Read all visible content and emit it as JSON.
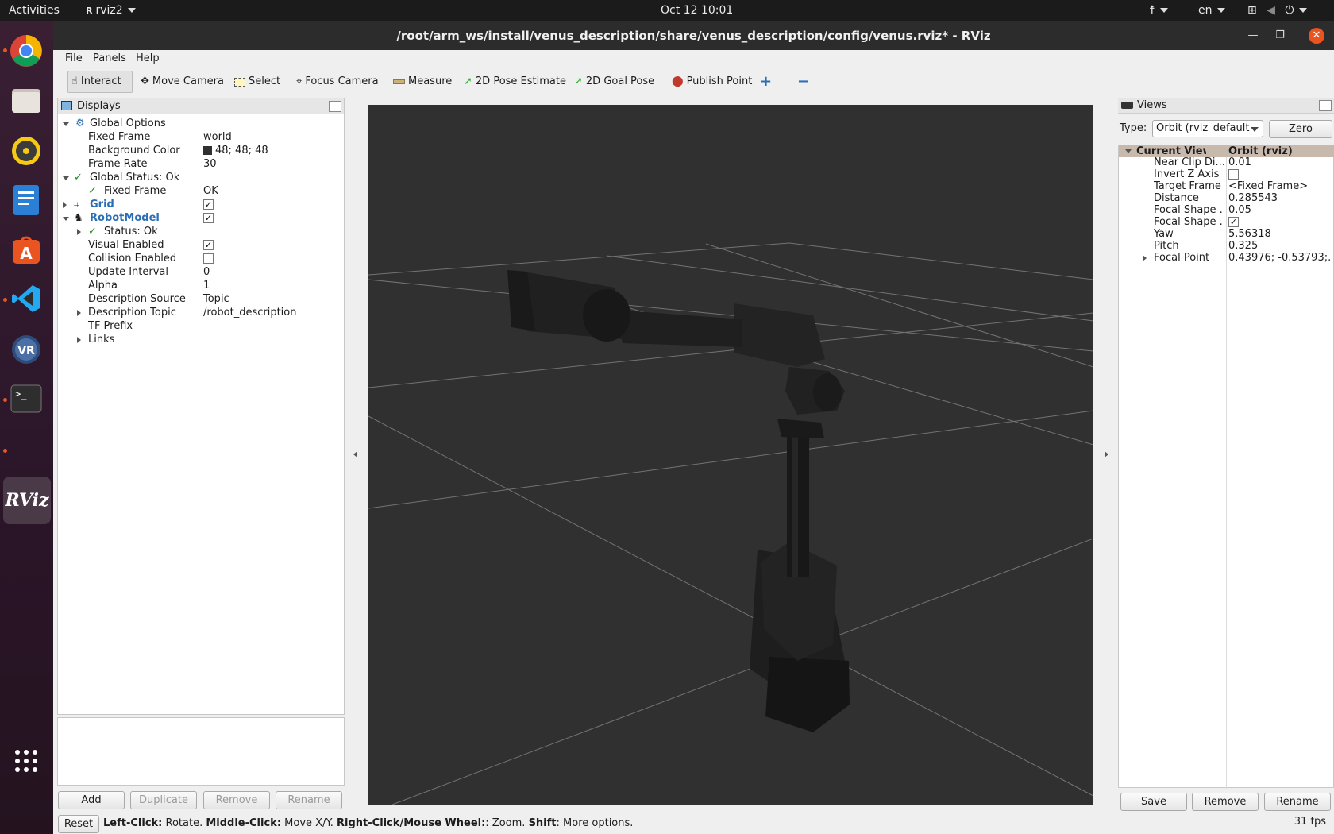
{
  "topbar": {
    "activities": "Activities",
    "app_name": "rviz2",
    "clock": "Oct 12  10:01",
    "lang": "en"
  },
  "window": {
    "title": "/root/arm_ws/install/venus_description/share/venus_description/config/venus.rviz* - RViz"
  },
  "menubar": {
    "items": [
      "File",
      "Panels",
      "Help"
    ]
  },
  "toolbar": {
    "tools": [
      "Interact",
      "Move Camera",
      "Select",
      "Focus Camera",
      "Measure",
      "2D Pose Estimate",
      "2D Goal Pose",
      "Publish Point"
    ]
  },
  "displays": {
    "title": "Displays",
    "rows": [
      {
        "label": "Global Options",
        "value": ""
      },
      {
        "label": "Fixed Frame",
        "value": "world"
      },
      {
        "label": "Background Color",
        "value": "48; 48; 48"
      },
      {
        "label": "Frame Rate",
        "value": "30"
      },
      {
        "label": "Global Status: Ok",
        "value": ""
      },
      {
        "label": "Fixed Frame",
        "value": "OK"
      },
      {
        "label": "Grid",
        "value": ""
      },
      {
        "label": "RobotModel",
        "value": ""
      },
      {
        "label": "Status: Ok",
        "value": ""
      },
      {
        "label": "Visual Enabled",
        "value": ""
      },
      {
        "label": "Collision Enabled",
        "value": ""
      },
      {
        "label": "Update Interval",
        "value": "0"
      },
      {
        "label": "Alpha",
        "value": "1"
      },
      {
        "label": "Description Source",
        "value": "Topic"
      },
      {
        "label": "Description Topic",
        "value": "/robot_description"
      },
      {
        "label": "TF Prefix",
        "value": ""
      },
      {
        "label": "Links",
        "value": ""
      }
    ],
    "checks": {
      "grid": true,
      "robotmodel": true,
      "visual_enabled": true,
      "collision_enabled": false
    },
    "buttons": [
      "Add",
      "Duplicate",
      "Remove",
      "Rename"
    ]
  },
  "views": {
    "title": "Views",
    "type_label": "Type:",
    "type_value": "Orbit (rviz_default_",
    "zero_label": "Zero",
    "header_left": "Current View",
    "header_right": "Orbit (rviz)",
    "rows": [
      {
        "label": "Near Clip Di...",
        "value": "0.01"
      },
      {
        "label": "Invert Z Axis",
        "value": ""
      },
      {
        "label": "Target Frame",
        "value": "<Fixed Frame>"
      },
      {
        "label": "Distance",
        "value": "0.285543"
      },
      {
        "label": "Focal Shape ...",
        "value": "0.05"
      },
      {
        "label": "Focal Shape ...",
        "value": ""
      },
      {
        "label": "Yaw",
        "value": "5.56318"
      },
      {
        "label": "Pitch",
        "value": "0.325"
      },
      {
        "label": "Focal Point",
        "value": "0.43976; -0.53793;..."
      }
    ],
    "checks": {
      "invert_z": false,
      "focal_shape_fixed": true
    },
    "buttons": [
      "Save",
      "Remove",
      "Rename"
    ]
  },
  "statusbar": {
    "reset": "Reset",
    "b1": "Left-Click:",
    "t1": " Rotate. ",
    "b2": "Middle-Click:",
    "t2": " Move X/Y. ",
    "b3": "Right-Click/Mouse Wheel:",
    "t3": ": Zoom. ",
    "b4": "Shift",
    "t4": ": More options.",
    "fps": "31 fps"
  },
  "colors": {
    "viewport_bg": "#303030",
    "accent": "#e95420",
    "link_blue": "#2a6fb5"
  },
  "dock_apps": [
    "chrome-icon",
    "files-icon",
    "rhythmbox-icon",
    "writer-icon",
    "software-center-icon",
    "vscode-icon",
    "vr-icon",
    "terminal-icon",
    "rviz-icon",
    "app-grid-icon"
  ]
}
